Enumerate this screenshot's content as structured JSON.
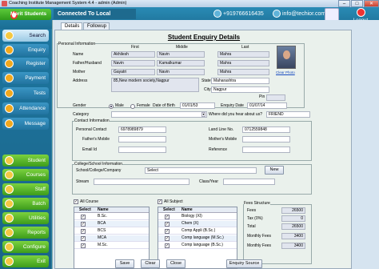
{
  "window": {
    "title": "Coaching Institute Management System 4.4  -  admin (Admin)",
    "min": "–",
    "max": "□",
    "close": "✕"
  },
  "brand": {
    "name": "Merit Students"
  },
  "header": {
    "connection": "Connected To Local Database",
    "phone": "+919766616435",
    "email": "info@techior.com",
    "logout": "Logout"
  },
  "sidebar": {
    "top": [
      {
        "label": "Search",
        "icon": "search-icon",
        "active": true
      },
      {
        "label": "Enquiry",
        "icon": "enquiry-icon"
      },
      {
        "label": "Register",
        "icon": "register-icon"
      },
      {
        "label": "Payment",
        "icon": "payment-icon"
      },
      {
        "label": "Tests",
        "icon": "tests-icon"
      },
      {
        "label": "Attendance",
        "icon": "attendance-icon"
      },
      {
        "label": "Message",
        "icon": "message-icon"
      }
    ],
    "bottom": [
      {
        "label": "Student",
        "icon": "student-icon"
      },
      {
        "label": "Courses",
        "icon": "courses-icon"
      },
      {
        "label": "Staff",
        "icon": "staff-icon"
      },
      {
        "label": "Batch",
        "icon": "batch-icon"
      },
      {
        "label": "Utilities",
        "icon": "utilities-icon"
      },
      {
        "label": "Reports",
        "icon": "reports-icon"
      },
      {
        "label": "Configure",
        "icon": "configure-icon"
      },
      {
        "label": "Exit",
        "icon": "exit-icon"
      }
    ]
  },
  "tabs": [
    "Details",
    "Followup"
  ],
  "form": {
    "title": "Student Enquiry Details",
    "personal_info": "Personal Information",
    "col_first": "First",
    "col_middle": "Middle",
    "col_last": "Last",
    "name_label": "Name",
    "name": [
      "Akhilesh",
      "Navin",
      "Mahra"
    ],
    "father_label": "Father/Husband",
    "father": [
      "Navin",
      "Kamalkumar",
      "Mahra"
    ],
    "mother_label": "Mother",
    "mother": [
      "Gayatri",
      "Navin",
      "Mahra"
    ],
    "address_label": "Address",
    "address": "85,New modern society,Nagpur",
    "state_label": "State",
    "state": "Maharashtra",
    "city_label": "City",
    "city": "Nagpur",
    "pin_label": "Pin",
    "pin": "",
    "clear_photo": "Clear Photo",
    "gender_label": "Gender",
    "male": "Male",
    "female": "Female",
    "dob_label": "Date of Birth",
    "dob": "01/01/53",
    "enquiry_date_label": "Enquiry Date",
    "enquiry_date": "01/07/14",
    "category_label": "Category",
    "category": "",
    "hear_label": "Where did you hear about us?",
    "hear": "FRIEND",
    "contact_info": "Contact Information",
    "personal_contact_label": "Personal Contact",
    "personal_contact": "6978989879",
    "landline_label": "Land Line No.",
    "landline": "0712559848",
    "fathers_mobile_label": "Father's Mobile",
    "fathers_mobile": "",
    "mothers_mobile_label": "Mother's Mobile",
    "mothers_mobile": "",
    "email_label": "Email Id",
    "email": "",
    "reference_label": "Reference",
    "reference": "",
    "college_info": "College/School Information",
    "school_label": "School/College/Company",
    "school": "Select",
    "new_btn": "New",
    "stream_label": "Stream",
    "stream": "",
    "class_label": "Class/Year",
    "class": ""
  },
  "courses": {
    "all_label": "All Course",
    "headers": [
      "Select",
      "Name"
    ],
    "rows": [
      {
        "checked": true,
        "name": "B.Sc."
      },
      {
        "checked": true,
        "name": "BCA"
      },
      {
        "checked": true,
        "name": "BCS"
      },
      {
        "checked": true,
        "name": "MCA"
      },
      {
        "checked": true,
        "name": "M.Sc."
      }
    ]
  },
  "subjects": {
    "all_label": "All Subject",
    "headers": [
      "Select",
      "Name"
    ],
    "rows": [
      {
        "checked": true,
        "name": "Biology (XI)"
      },
      {
        "checked": true,
        "name": "Chem (X)"
      },
      {
        "checked": true,
        "name": "Comp Appli (B.Sc.)"
      },
      {
        "checked": true,
        "name": "Comp language (M.Sc.)"
      },
      {
        "checked": true,
        "name": "Comp language (B.Sc.)"
      }
    ]
  },
  "fees": {
    "title": "Fees Structure",
    "fees_label": "Fees",
    "fees": "26500",
    "tax_label": "Tax (0%)",
    "tax": "0",
    "total_label": "Total",
    "total": "26500",
    "months_label": "Monthly Fees",
    "months": "3400",
    "monthly_label": "Monthly Fees",
    "monthly": "3400"
  },
  "buttons": {
    "save": "Save",
    "clear": "Clear",
    "close": "Close",
    "source": "Enquiry Source"
  }
}
